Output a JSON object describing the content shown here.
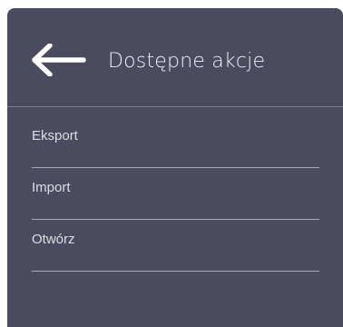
{
  "header": {
    "back_icon": "arrow-left-icon",
    "title": "Dostępne akcje"
  },
  "menu": {
    "items": [
      {
        "label": "Eksport"
      },
      {
        "label": "Import"
      },
      {
        "label": "Otwórz"
      }
    ]
  },
  "colors": {
    "panel_background": "#4a4b5e",
    "text": "#f2f2f5",
    "divider": "#a9aab8"
  }
}
